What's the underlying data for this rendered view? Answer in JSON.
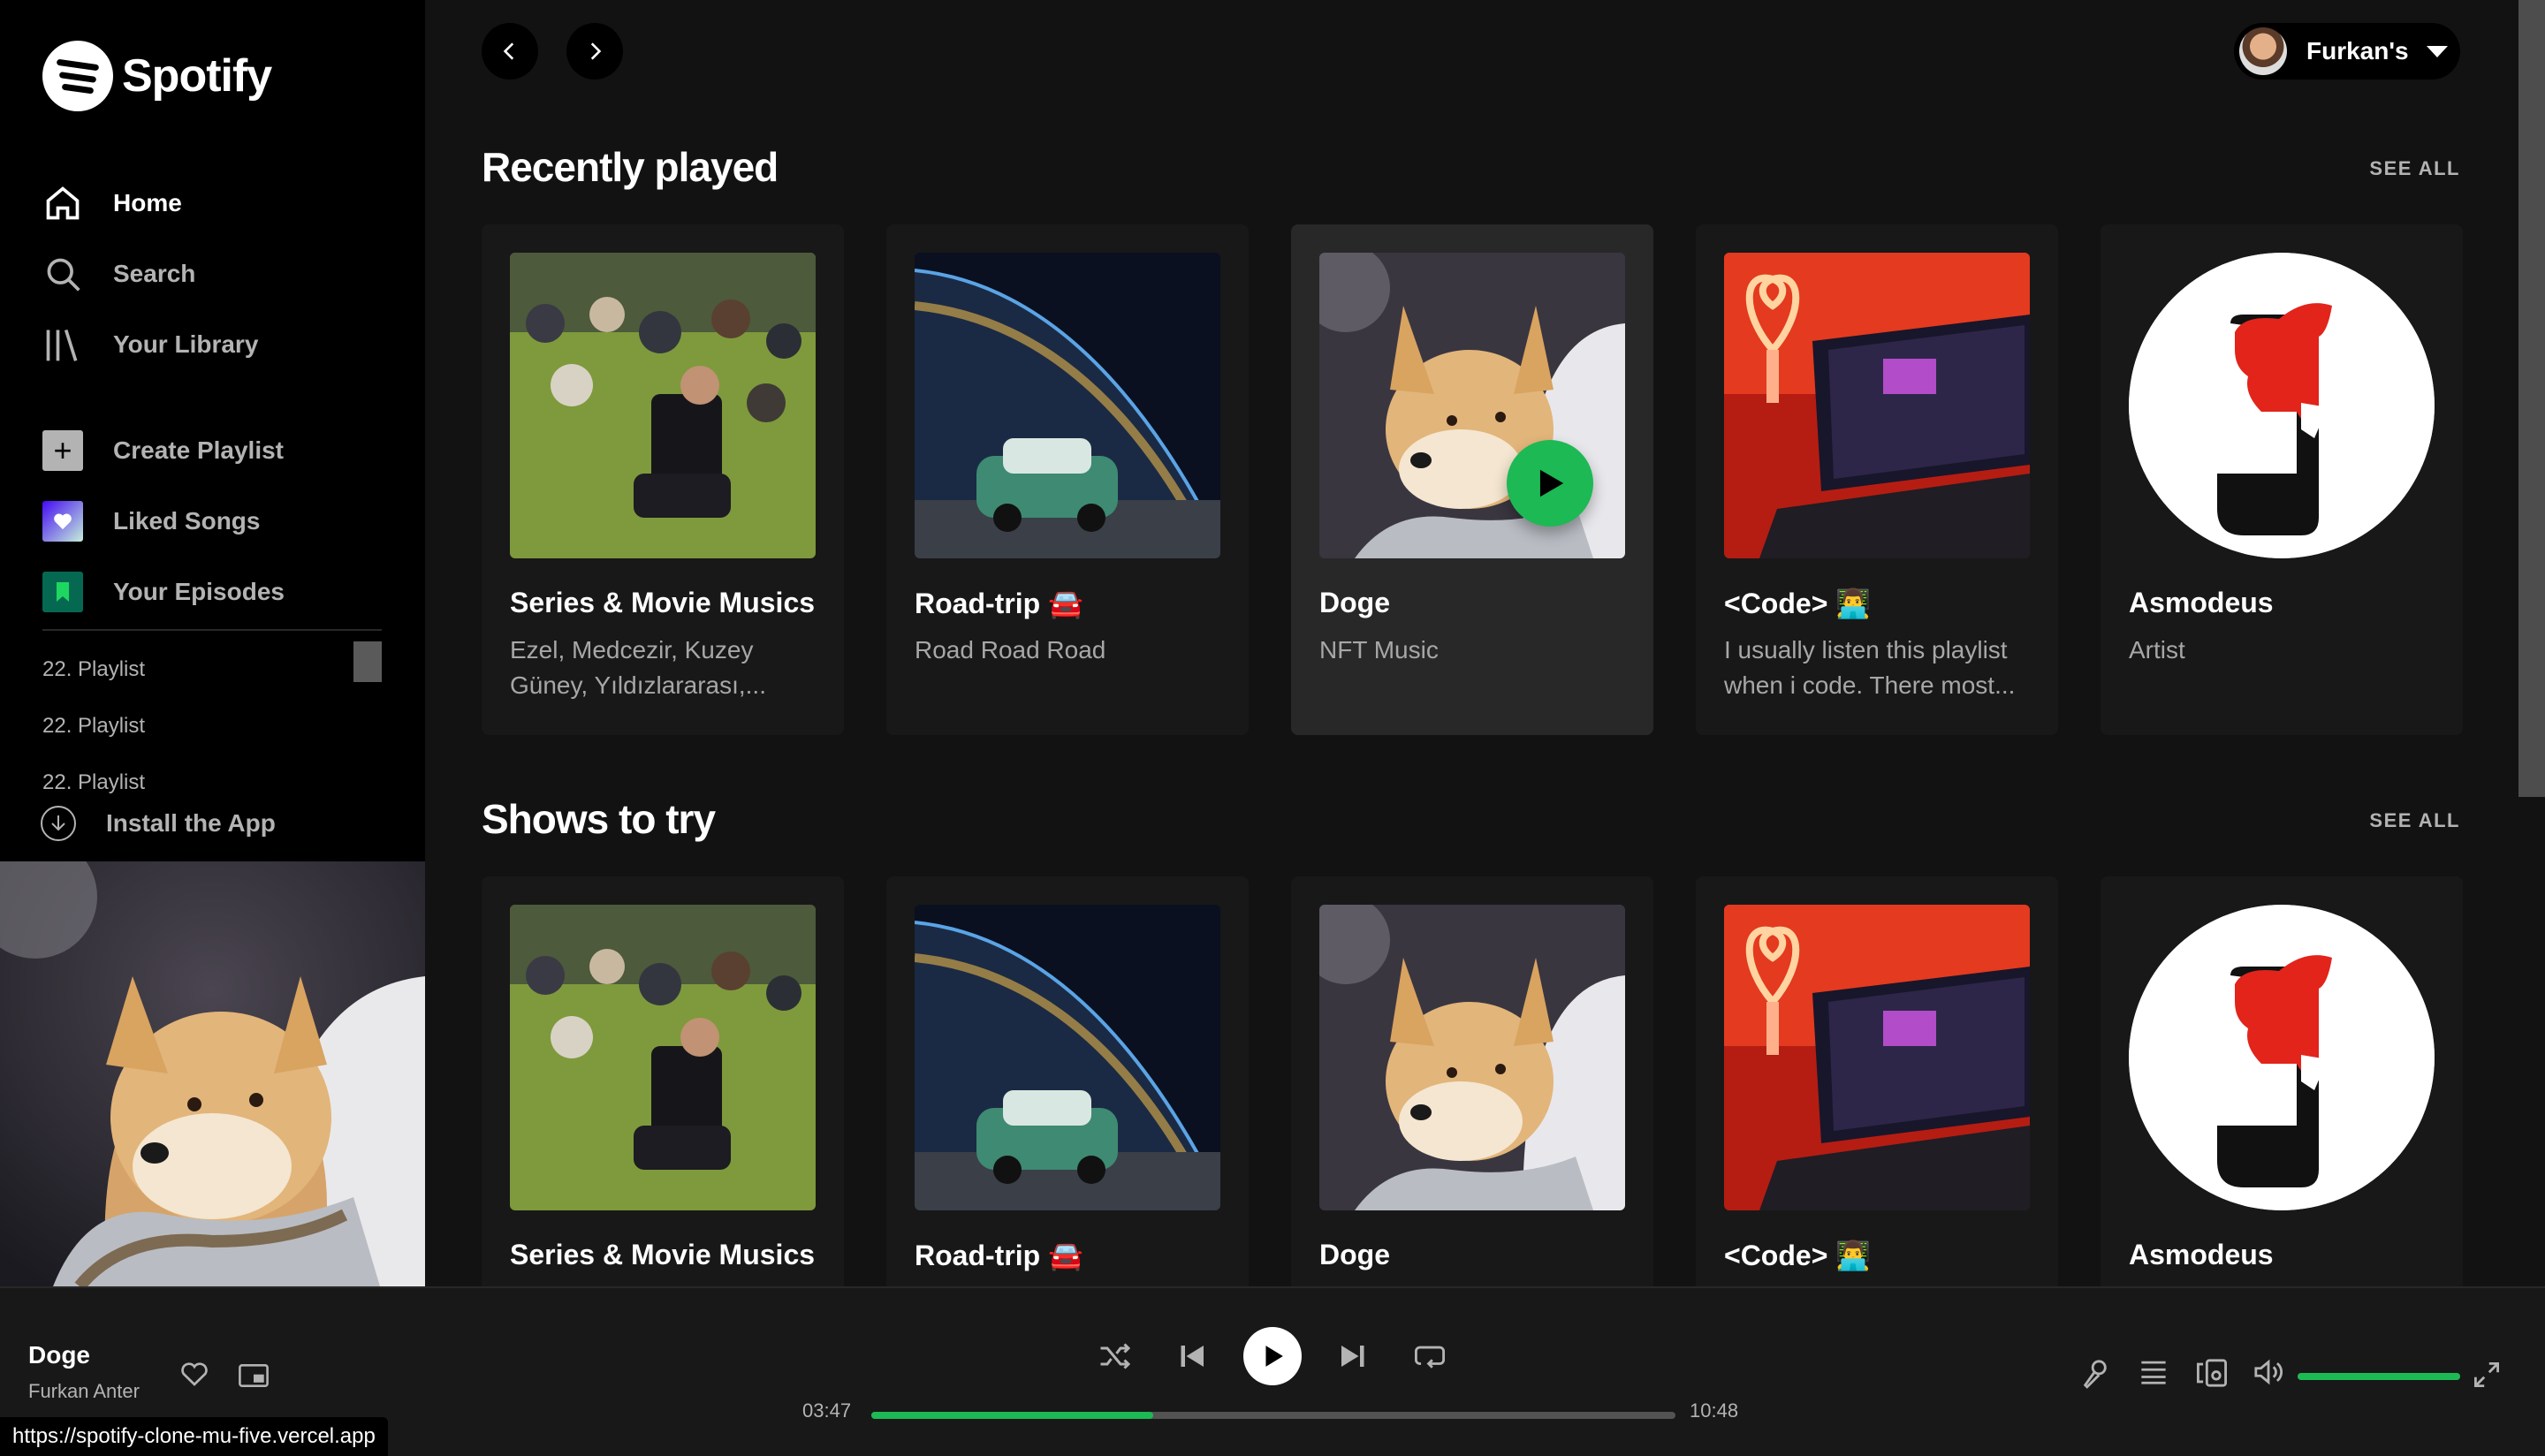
{
  "app": {
    "name": "Spotify"
  },
  "sidebar": {
    "nav": [
      {
        "label": "Home",
        "icon": "home-icon",
        "active": true
      },
      {
        "label": "Search",
        "icon": "search-icon",
        "active": false
      },
      {
        "label": "Your Library",
        "icon": "library-icon",
        "active": false
      }
    ],
    "actions": [
      {
        "label": "Create Playlist",
        "icon": "plus-icon"
      },
      {
        "label": "Liked Songs",
        "icon": "heart-icon"
      },
      {
        "label": "Your Episodes",
        "icon": "bookmark-icon"
      }
    ],
    "playlists": [
      "22. Playlist",
      "22. Playlist",
      "22. Playlist"
    ],
    "install_label": "Install the App"
  },
  "header": {
    "user_name": "Furkan's"
  },
  "sections": [
    {
      "title": "Recently played",
      "see_all": "SEE ALL",
      "cards": [
        {
          "title": "Series & Movie Musics",
          "subtitle": "Ezel, Medcezir, Kuzey Güney, Yıldızlararası,...",
          "art": "park-meme"
        },
        {
          "title": "Road-trip 🚘",
          "subtitle": "Road Road Road",
          "art": "earth-car"
        },
        {
          "title": "Doge",
          "subtitle": "NFT Music",
          "art": "doge",
          "hover": true
        },
        {
          "title": "<Code> 👨‍💻",
          "subtitle": "I usually listen this playlist when i code. There most...",
          "art": "laptop"
        },
        {
          "title": "Asmodeus",
          "subtitle": "Artist",
          "art": "asmodeus"
        }
      ]
    },
    {
      "title": "Shows to try",
      "see_all": "SEE ALL",
      "cards": [
        {
          "title": "Series & Movie Musics",
          "subtitle": "",
          "art": "park-meme"
        },
        {
          "title": "Road-trip 🚘",
          "subtitle": "",
          "art": "earth-car"
        },
        {
          "title": "Doge",
          "subtitle": "",
          "art": "doge"
        },
        {
          "title": "<Code> 👨‍💻",
          "subtitle": "",
          "art": "laptop"
        },
        {
          "title": "Asmodeus",
          "subtitle": "",
          "art": "asmodeus"
        }
      ]
    }
  ],
  "player": {
    "track": "Doge",
    "artist": "Furkan Anter",
    "elapsed": "03:47",
    "duration": "10:48",
    "progress": 0.35,
    "volume": 1.0
  },
  "status_url": "https://spotify-clone-mu-five.vercel.app",
  "colors": {
    "accent": "#1db954",
    "background": "#121212",
    "sidebar": "#000000"
  }
}
